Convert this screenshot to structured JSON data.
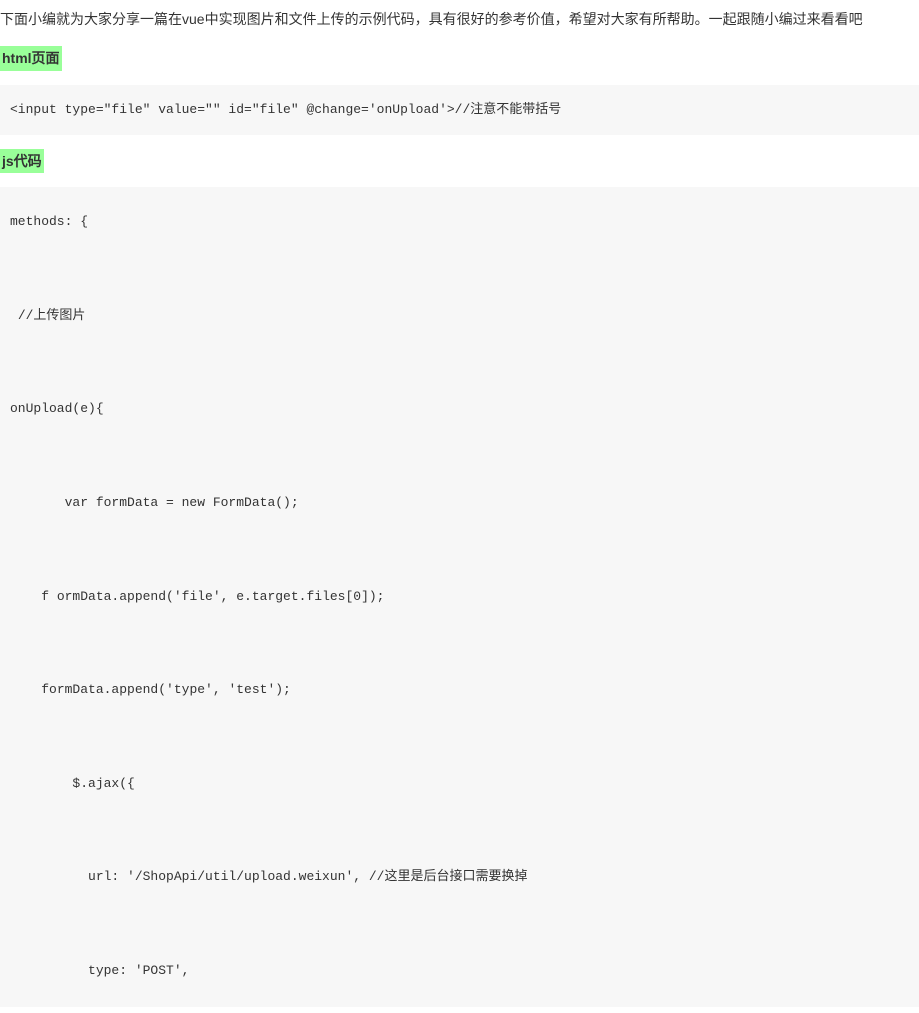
{
  "intro": "下面小编就为大家分享一篇在vue中实现图片和文件上传的示例代码，具有很好的参考价值，希望对大家有所帮助。一起跟随小编过来看看吧",
  "headings": {
    "html_page": "html页面",
    "js_code": "js代码"
  },
  "code": {
    "html_snippet": "<input type=\"file\" value=\"\" id=\"file\" @change='onUpload'>//注意不能带括号",
    "js_snippet": "methods: {\n\n //上传图片\n\nonUpload(e){\n\n       var formData = new FormData();\n\n    f ormData.append('file', e.target.files[0]);\n\n    formData.append('type', 'test');\n\n        $.ajax({\n\n          url: '/ShopApi/util/upload.weixun', //这里是后台接口需要换掉\n\n          type: 'POST',"
  }
}
